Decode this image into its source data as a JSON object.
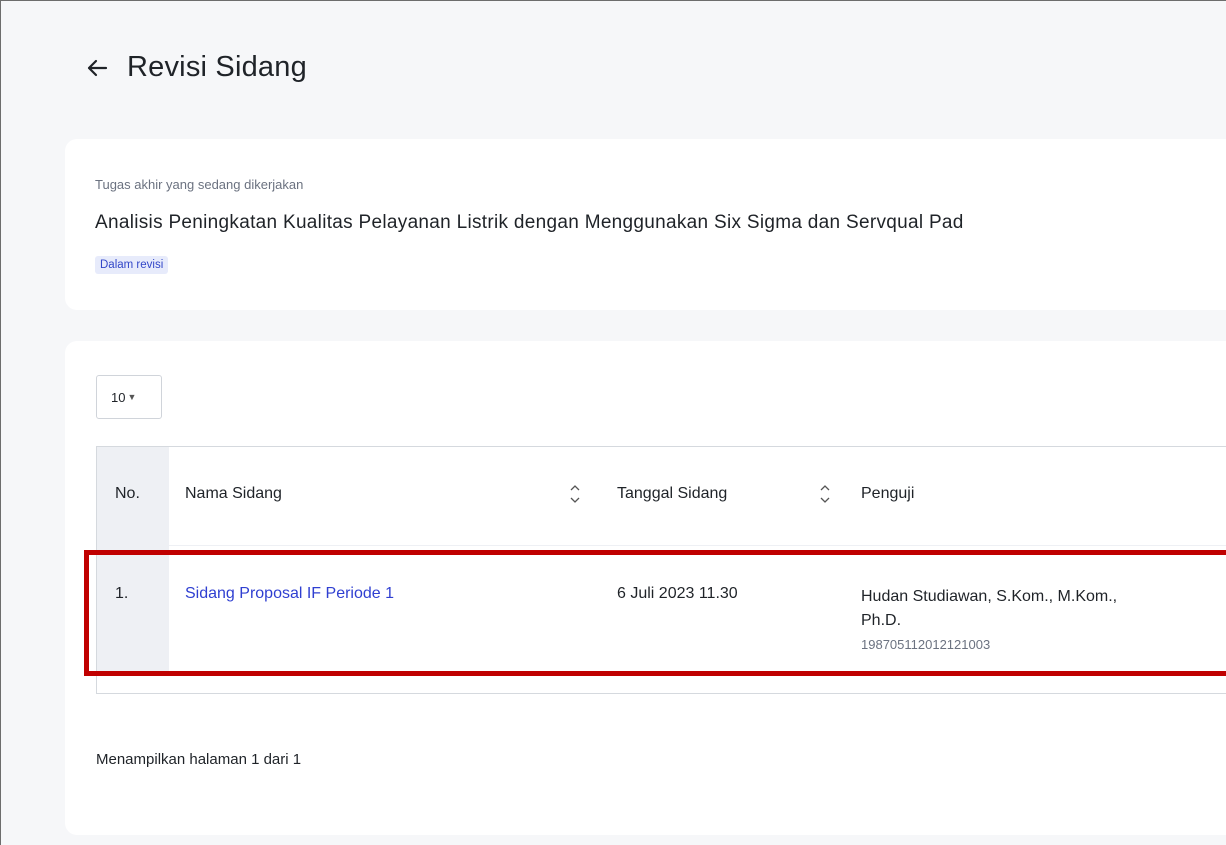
{
  "page": {
    "title": "Revisi Sidang"
  },
  "thesis_card": {
    "label": "Tugas akhir yang sedang dikerjakan",
    "title": "Analisis Peningkatan Kualitas Pelayanan Listrik dengan Menggunakan Six Sigma dan Servqual Pad",
    "status_badge": "Dalam revisi"
  },
  "table": {
    "page_size": "10",
    "columns": [
      "No.",
      "Nama Sidang",
      "Tanggal Sidang",
      "Penguji"
    ],
    "rows": [
      {
        "no": "1.",
        "nama_sidang": "Sidang Proposal IF Periode 1",
        "tanggal": "6 Juli 2023 11.30",
        "penguji_nama_1": "Hudan Studiawan, S.Kom., M.Kom.,",
        "penguji_nama_2": "Ph.D.",
        "penguji_nip": "198705112012121003"
      }
    ],
    "footer": "Menampilkan halaman 1 dari 1"
  },
  "colors": {
    "link": "#2f3fd1",
    "badge_bg": "#e7ebfb",
    "highlight": "#c00000"
  },
  "icons": {
    "back": "arrow-left-icon",
    "sort": "sort-icon",
    "caret": "caret-down-icon"
  }
}
